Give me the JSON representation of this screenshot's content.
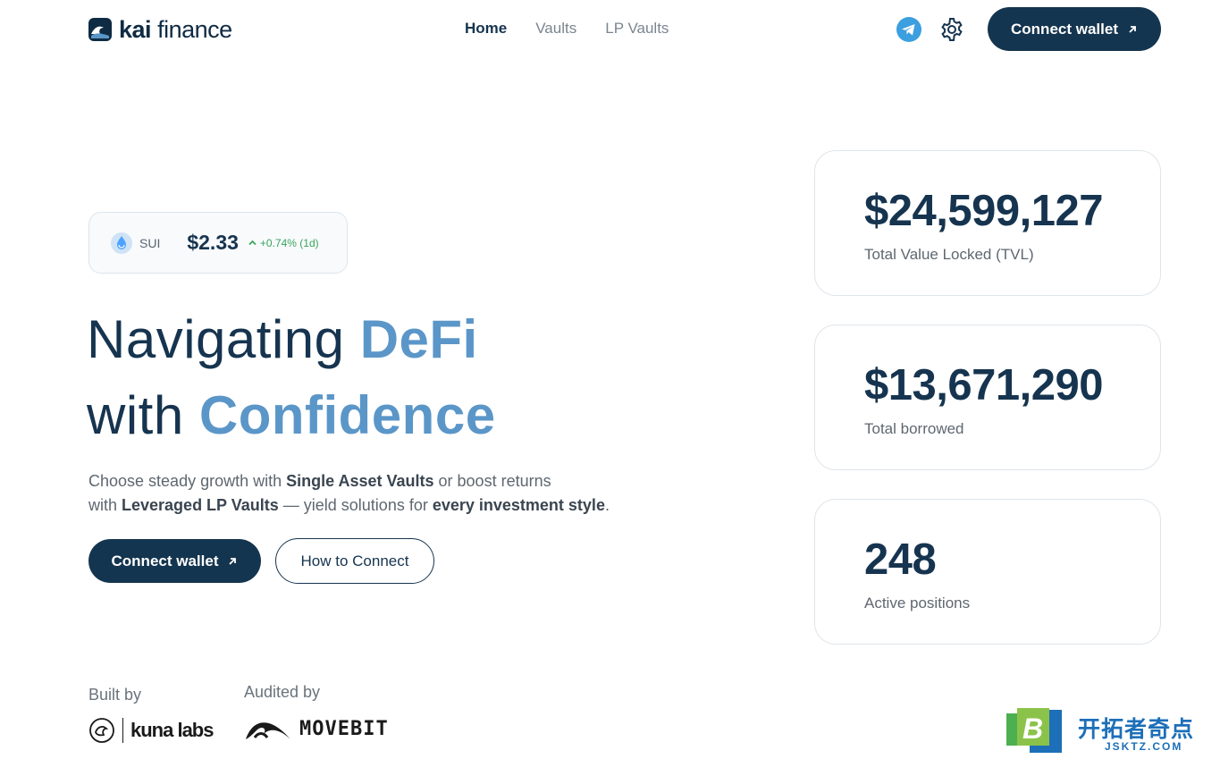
{
  "header": {
    "logo_bold": "kai",
    "logo_light": "finance",
    "nav": [
      {
        "label": "Home",
        "active": true
      },
      {
        "label": "Vaults",
        "active": false
      },
      {
        "label": "LP Vaults",
        "active": false
      }
    ],
    "connect_label": "Connect wallet",
    "telegram_icon": "telegram-icon",
    "settings_icon": "gear-icon"
  },
  "price": {
    "token": "SUI",
    "value": "$2.33",
    "change": "+0.74% (1d)"
  },
  "hero": {
    "title_line1": "Navigating ",
    "title_accent1": "DeFi",
    "title_line2": "with ",
    "title_accent2": "Confidence",
    "desc_1": "Choose steady growth with ",
    "desc_b1": "Single Asset Vaults",
    "desc_2": " or boost returns",
    "desc_3": "with ",
    "desc_b2": "Leveraged LP Vaults",
    "desc_4": " — yield solutions for ",
    "desc_b3": "every investment style",
    "desc_5": ".",
    "connect_label": "Connect wallet",
    "how_label": "How to Connect"
  },
  "stats": [
    {
      "value": "$24,599,127",
      "label": "Total Value Locked (TVL)"
    },
    {
      "value": "$13,671,290",
      "label": "Total borrowed"
    },
    {
      "value": "248",
      "label": "Active positions"
    }
  ],
  "partners": {
    "built_label": "Built by",
    "built_name": "kuna labs",
    "audited_label": "Audited by",
    "audited_name": "MOVEBIT"
  },
  "watermark": {
    "letter": "B",
    "title": "开拓者奇点",
    "sub": "JSKTZ.COM"
  },
  "colors": {
    "navy": "#14354f",
    "accent": "#5b96c8",
    "positive": "#3aa55c"
  }
}
